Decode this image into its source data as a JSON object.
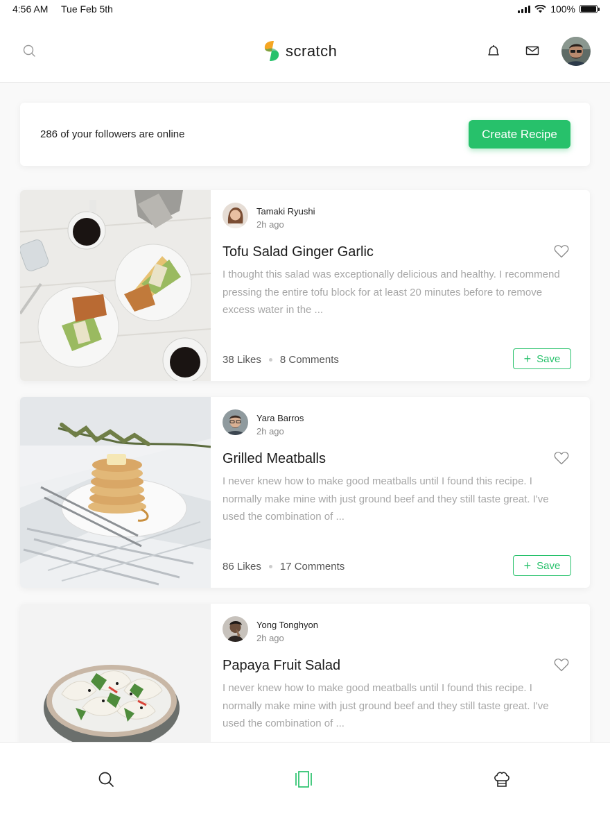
{
  "status_bar": {
    "time": "4:56 AM",
    "date": "Tue Feb 5th",
    "battery": "100%"
  },
  "header": {
    "app_name": "scratch",
    "icons": [
      "search-icon",
      "bell-icon",
      "mail-icon",
      "user-avatar"
    ]
  },
  "followers": {
    "text": "286 of your followers are online",
    "button_label": "Create Recipe"
  },
  "colors": {
    "accent": "#27c16b",
    "logo_orange": "#f5a623",
    "logo_green": "#27c16b"
  },
  "recipes": [
    {
      "author": "Tamaki Ryushi",
      "time": "2h ago",
      "title": "Tofu Salad Ginger Garlic",
      "description": "I thought this salad was exceptionally delicious and healthy. I recommend pressing the entire tofu block for at least 20 minutes before to remove excess water in the ...",
      "likes": "38 Likes",
      "comments": "8 Comments",
      "save_label": "Save"
    },
    {
      "author": "Yara Barros",
      "time": "2h ago",
      "title": "Grilled Meatballs",
      "description": "I never knew how to make good meatballs until I found this recipe. I normally make mine with just ground beef and they still taste great. I've used the combination of ...",
      "likes": "86 Likes",
      "comments": "17 Comments",
      "save_label": "Save"
    },
    {
      "author": "Yong Tonghyon",
      "time": "2h ago",
      "title": "Papaya Fruit Salad",
      "description": "I never knew how to make good meatballs until I found this recipe. I normally make mine with just ground beef and they still taste great. I've used the combination of ...",
      "likes": "",
      "comments": "",
      "save_label": ""
    }
  ],
  "tab_bar": {
    "tabs": [
      "search-icon",
      "feed-icon",
      "chef-hat-icon"
    ],
    "active": "feed-icon"
  }
}
